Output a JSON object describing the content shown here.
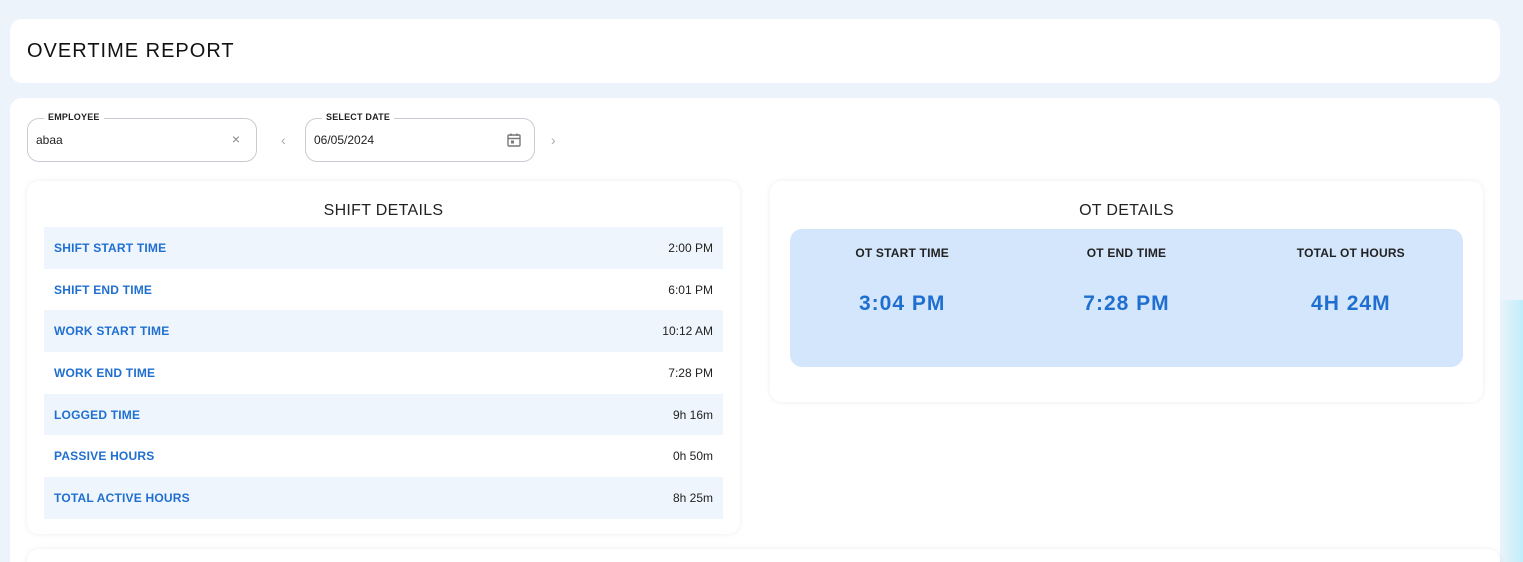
{
  "page": {
    "title": "OVERTIME REPORT"
  },
  "filters": {
    "employee": {
      "label": "EMPLOYEE",
      "value": "abaa"
    },
    "date": {
      "label": "SELECT DATE",
      "value": "06/05/2024"
    },
    "prev_arrow": "‹",
    "next_arrow": "›",
    "clear_glyph": "×"
  },
  "shift_details": {
    "title": "SHIFT DETAILS",
    "rows": [
      {
        "label": "SHIFT START TIME",
        "value": "2:00 PM"
      },
      {
        "label": "SHIFT END TIME",
        "value": "6:01 PM"
      },
      {
        "label": "WORK START TIME",
        "value": "10:12 AM"
      },
      {
        "label": "WORK END TIME",
        "value": "7:28 PM"
      },
      {
        "label": "LOGGED TIME",
        "value": "9h 16m"
      },
      {
        "label": "PASSIVE HOURS",
        "value": "0h 50m"
      },
      {
        "label": "TOTAL ACTIVE HOURS",
        "value": "8h 25m"
      }
    ]
  },
  "ot_details": {
    "title": "OT DETAILS",
    "items": [
      {
        "label": "OT START TIME",
        "value": "3:04 PM"
      },
      {
        "label": "OT END TIME",
        "value": "7:28 PM"
      },
      {
        "label": "TOTAL OT HOURS",
        "value": "4H 24M"
      }
    ]
  },
  "colors": {
    "accent": "#1f6fd1",
    "row_stripe": "#eff5fc",
    "ot_box": "#d4e6fc",
    "background": "#edf3fa"
  }
}
